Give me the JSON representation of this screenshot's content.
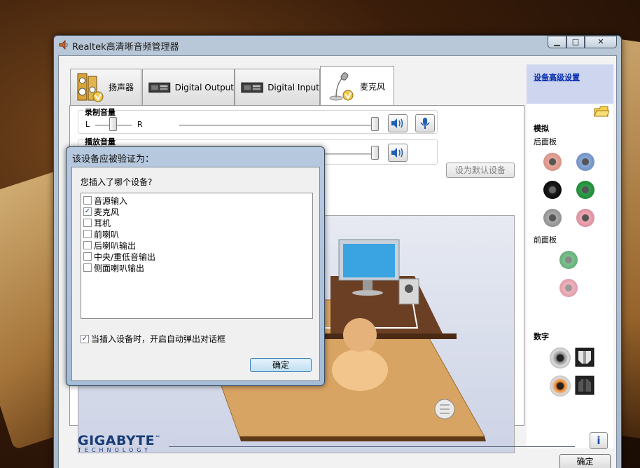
{
  "window": {
    "title": "Realtek高清晰音频管理器",
    "buttons": {
      "minimize": "▁",
      "maximize": "□",
      "close": "✕"
    }
  },
  "tabs": [
    {
      "label": "扬声器",
      "icon": "speaker-icon"
    },
    {
      "label": "Digital Output",
      "icon": "digital-output-icon"
    },
    {
      "label": "Digital Input",
      "icon": "digital-input-icon"
    },
    {
      "label": "麦克风",
      "icon": "microphone-icon",
      "active": true
    }
  ],
  "recording_volume": {
    "title": "录制音量",
    "left_label": "L",
    "right_label": "R",
    "level": 1.0
  },
  "playback_volume": {
    "title": "播放音量",
    "level": 1.0
  },
  "set_default_button": "设为默认设备",
  "right_panel": {
    "advanced_link": "设备高级设置",
    "analog_label": "模拟",
    "back_panel_label": "后面板",
    "front_panel_label": "前面板",
    "digital_label": "数字",
    "back_jack_colors": [
      "#e8a79a",
      "#8aa9d9",
      "#1b1b1b",
      "#2fa04a",
      "#a9a9a9",
      "#f1a8b5"
    ],
    "front_jack_colors": [
      "#7cc28f",
      "#f1b3bd"
    ]
  },
  "bottom": {
    "logo_main": "GIGABYTE",
    "logo_tm": "™",
    "logo_sub": "TECHNOLOGY",
    "info_icon": "i",
    "ok_button": "确定"
  },
  "dialog": {
    "title": "该设备应被验证为：",
    "question": "您插入了哪个设备?",
    "options": [
      {
        "label": "音源输入",
        "checked": false
      },
      {
        "label": "麦克风",
        "checked": true
      },
      {
        "label": "耳机",
        "checked": false
      },
      {
        "label": "前喇叭",
        "checked": false
      },
      {
        "label": "后喇叭输出",
        "checked": false
      },
      {
        "label": "中央/重低音输出",
        "checked": false
      },
      {
        "label": "侧面喇叭输出",
        "checked": false
      }
    ],
    "auto_popup_label": "当插入设备时，开启自动弹出对话框",
    "auto_popup_checked": true,
    "ok_button": "确定"
  }
}
